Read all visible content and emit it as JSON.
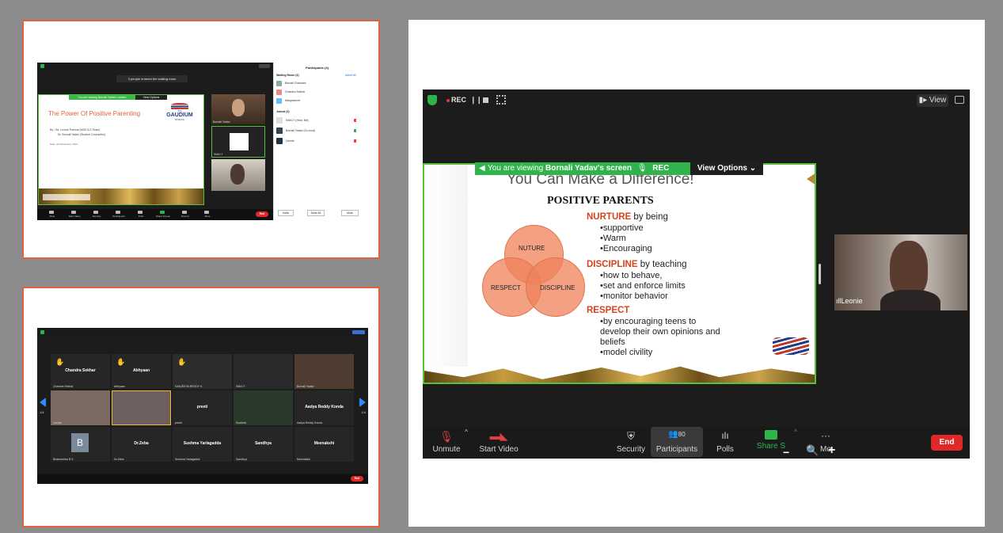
{
  "top_left": {
    "waiting_toast": "3 people entered the waiting room",
    "viewing_banner": "You are viewing Bornali Yadav's screen",
    "view_options": "View Options",
    "slide_title": "The Power Of Positive Parenting",
    "slide_by_1": "By :  Rs. Leonie Parimal (MSD ILS Team)",
    "slide_by_2": "Dr. Bornali Yadav (Student Counsellor)",
    "slide_date": "Date: 3rd December, 2021",
    "logo_the": "The",
    "logo_name": "GAUDIUM",
    "logo_school": "SCHOOL",
    "thumb1_label": "Bornali Yadav",
    "thumb2_label": "SMA IT",
    "participants_title": "Participants (4)",
    "waiting_room_label": "Waiting Room (3)",
    "admit_all": "Admit All",
    "waiting": [
      "Bornali Goswami",
      "Chandra Sekhar",
      "Manyashree"
    ],
    "joined_label": "Joined (3)",
    "joined": [
      "SMA IT (Host, Me)",
      "Bornali Yadav (Co-host)",
      "Leonie"
    ],
    "invite": "Invite",
    "mute_all": "Mute All",
    "more": "More",
    "toolbar": [
      "Mute",
      "Start Video",
      "Security",
      "Participants",
      "Polls",
      "Share Screen",
      "Record",
      "More"
    ],
    "end": "End"
  },
  "bottom_left": {
    "tiles": [
      {
        "name": "Chandra Sekhar",
        "foot": "Chandra Sekhar"
      },
      {
        "name": "Abhyaan",
        "foot": "Abhyaan"
      },
      {
        "name": "",
        "foot": "SANJEEVA REDDY S"
      },
      {
        "name": "",
        "foot": "SMA IT"
      },
      {
        "name": "",
        "foot": "Bornali Yadav"
      },
      {
        "name": "",
        "foot": "Leonie"
      },
      {
        "name": "",
        "foot": ""
      },
      {
        "name": "preeti",
        "foot": "preeti"
      },
      {
        "name": "",
        "foot": "Sushma"
      },
      {
        "name": "Aadya Reddy Konda",
        "foot": "Aadya Reddy Konda"
      },
      {
        "name": "B",
        "foot": "Bhanurekha B S"
      },
      {
        "name": "Dr.Zeba",
        "foot": "Dr.Zeba"
      },
      {
        "name": "Sushma Yarlagadda",
        "foot": "Sushma Yarlagadda"
      },
      {
        "name": "Sandhya",
        "foot": "Sandhya"
      },
      {
        "name": "Meenakshi",
        "foot": "Meenakshi"
      }
    ],
    "page_left": "1/4",
    "page_right": "1/4",
    "end": "End"
  },
  "main": {
    "rec": "REC",
    "view": "View",
    "viewing_prefix": "You are viewing",
    "viewing_name": "Bornali Yadav's screen",
    "rec_small": "REC",
    "view_options": "View Options",
    "slide_heading": "You Can Make a Difference!",
    "positive_parents": "POSITIVE PARENTS",
    "nurture_head": "NURTURE",
    "nurture_tail": " by being",
    "nurture_items": [
      "•supportive",
      "•Warm",
      "•Encouraging"
    ],
    "discipline_head": "DISCIPLINE",
    "discipline_tail": " by teaching",
    "discipline_items": [
      "•how to behave,",
      "•set and enforce limits",
      "•monitor behavior"
    ],
    "respect_head": "RESPECT",
    "respect_items": [
      "•by encouraging teens to",
      "develop their own opinions and",
      "beliefs",
      "•model civility"
    ],
    "venn": {
      "top": "NUTURE",
      "left": "RESPECT",
      "right": "DISCIPLINE"
    },
    "speaker_name": "Leonie",
    "participants_count": "80",
    "toolbar": {
      "unmute": "Unmute",
      "start_video": "Start Video",
      "security": "Security",
      "participants": "Participants",
      "polls": "Polls",
      "share": "Share S",
      "more": "Mo",
      "end": "End"
    }
  }
}
